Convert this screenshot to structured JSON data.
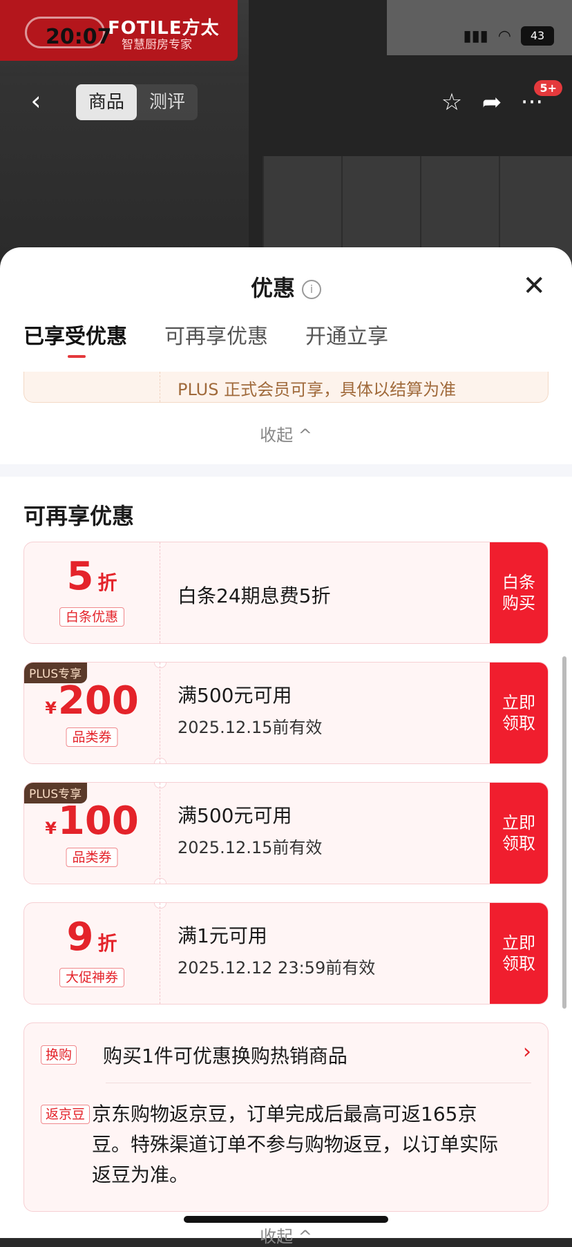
{
  "status_bar": {
    "time": "20:07",
    "battery": "43"
  },
  "brand": {
    "name": "FOTILE方太",
    "subtitle": "智慧厨房专家"
  },
  "nav": {
    "tabs": [
      "商品",
      "测评"
    ],
    "cart_badge": "5+"
  },
  "sheet": {
    "title": "优惠",
    "tabs": [
      "已享受优惠",
      "可再享优惠",
      "开通立享"
    ],
    "plus_note": "PLUS 正式会员可享，具体以结算为准",
    "collapse_label": "收起 ^",
    "section_title": "可再享优惠",
    "coupons": [
      {
        "value": "5",
        "unit": "折",
        "tag": "白条优惠",
        "desc": "白条24期息费5折",
        "action": "白条购买"
      },
      {
        "badge": "PLUS专享",
        "currency": "¥",
        "value": "200",
        "tag": "品类券",
        "desc": "满500元可用",
        "validity": "2025.12.15前有效",
        "action": "立即领取"
      },
      {
        "badge": "PLUS专享",
        "currency": "¥",
        "value": "100",
        "tag": "品类券",
        "desc": "满500元可用",
        "validity": "2025.12.15前有效",
        "action": "立即领取"
      },
      {
        "value": "9",
        "unit": "折",
        "tag": "大促神券",
        "desc": "满1元可用",
        "validity": "2025.12.12 23:59前有效",
        "action": "立即领取"
      }
    ],
    "benefits": {
      "exchange_tag": "换购",
      "exchange_text": "购买1件可优惠换购热销商品",
      "beans_tag": "返京豆",
      "beans_text": "京东购物返京豆，订单完成后最高可返165京豆。特殊渠道订单不参与购物返豆，以订单实际返豆为准。"
    },
    "bottom_collapse_label": "收起 ^"
  }
}
